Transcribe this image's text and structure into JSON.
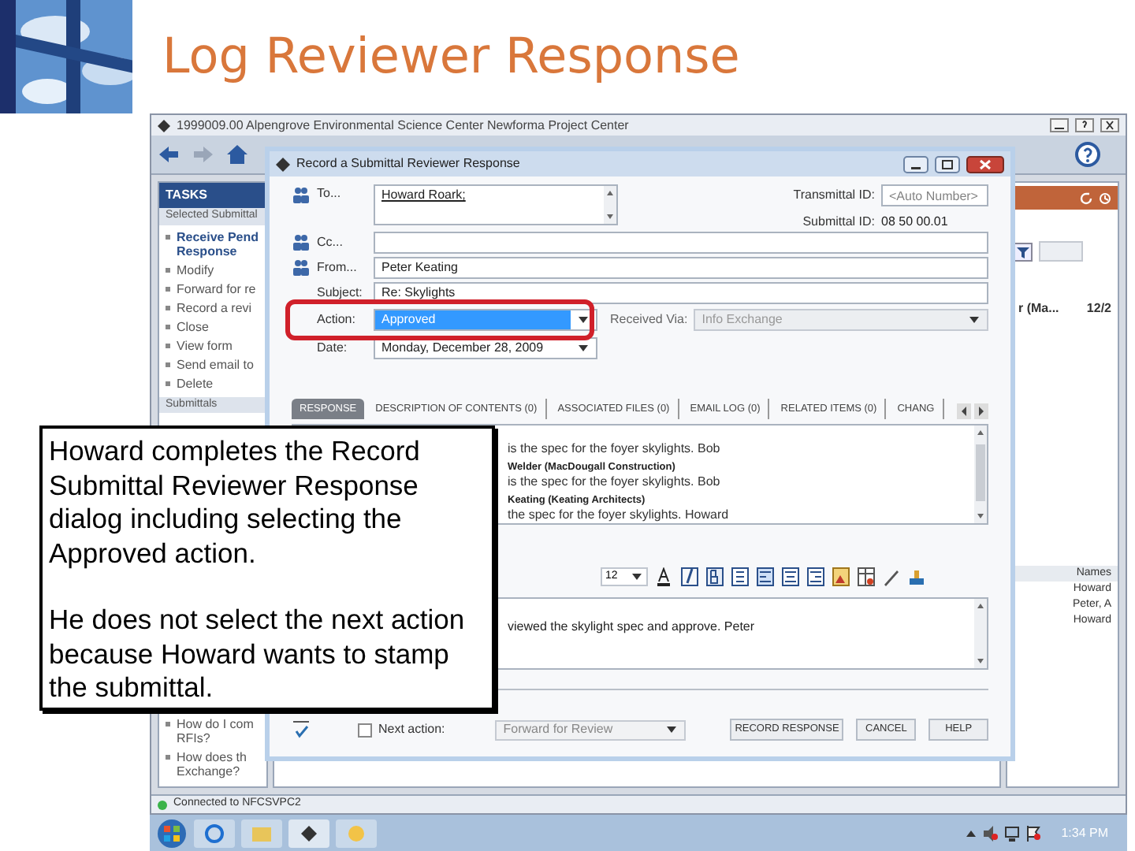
{
  "slide": {
    "title": "Log Reviewer Response"
  },
  "app": {
    "title": "1999009.00  Alpengrove Environmental Science Center  Newforma Project Center",
    "tasks": {
      "header": "TASKS",
      "section": "Selected Submittal",
      "items": [
        {
          "lines": [
            "Receive Pend",
            "Response"
          ],
          "bold": true
        },
        {
          "lines": [
            "Modify"
          ],
          "bold": false
        },
        {
          "lines": [
            "Forward for re"
          ],
          "bold": false
        },
        {
          "lines": [
            "Record a revi"
          ],
          "bold": false
        },
        {
          "lines": [
            "Close"
          ],
          "bold": false
        },
        {
          "lines": [
            "View form"
          ],
          "bold": false
        },
        {
          "lines": [
            "Send email to"
          ],
          "bold": false
        },
        {
          "lines": [
            "Delete"
          ],
          "bold": false
        }
      ],
      "section_2": "Submittals",
      "help_items": [
        {
          "lines": [
            "How do I com",
            "RFIs?"
          ]
        },
        {
          "lines": [
            "How does th",
            "Exchange?"
          ]
        }
      ]
    },
    "right_panel": {
      "cells": [
        "r (Ma...",
        "12/2"
      ],
      "names_header": "Names",
      "names": [
        "Howard",
        "Peter, A",
        "Howard"
      ]
    },
    "status": "Connected to NFCSVPC2",
    "clock": "1:34 PM"
  },
  "dialog": {
    "title": "Record a Submittal Reviewer Response",
    "to": {
      "label": "To...",
      "value": "Howard Roark;"
    },
    "transmittal_id": {
      "label": "Transmittal ID:",
      "placeholder": "<Auto Number>"
    },
    "submittal_id": {
      "label": "Submittal ID:",
      "value": "08 50 00.01"
    },
    "cc": {
      "label": "Cc..."
    },
    "from": {
      "label": "From...",
      "value": "Peter Keating"
    },
    "subject": {
      "label": "Subject:",
      "value": "Re: Skylights"
    },
    "action": {
      "label": "Action:",
      "value": "Approved",
      "highlighted": true
    },
    "received_via": {
      "label": "Received Via:",
      "value": "Info Exchange",
      "disabled": true
    },
    "date": {
      "label": "Date:",
      "value": "Monday, December 28, 2009"
    },
    "tabs": [
      {
        "label": "RESPONSE",
        "selected": true
      },
      {
        "label": "DESCRIPTION OF CONTENTS (0)",
        "selected": false
      },
      {
        "label": "ASSOCIATED FILES (0)",
        "selected": false
      },
      {
        "label": "EMAIL LOG (0)",
        "selected": false
      },
      {
        "label": "RELATED ITEMS (0)",
        "selected": false
      },
      {
        "label": "CHANG",
        "selected": false
      }
    ],
    "log": [
      {
        "kind": "text",
        "text": "is the spec for the foyer skylights.  Bob"
      },
      {
        "kind": "author",
        "text": "Welder (MacDougall Construction)"
      },
      {
        "kind": "text",
        "text": "is the spec for the foyer skylights.  Bob"
      },
      {
        "kind": "author",
        "text": "Keating (Keating Architects)"
      },
      {
        "kind": "text",
        "text": "the spec for the foyer skylights.  Howard"
      }
    ],
    "font_size": "12",
    "reply": "viewed the skylight spec and approve.  Peter",
    "next_action": {
      "label": "Next action:",
      "checked": false,
      "value": "Forward for Review"
    },
    "buttons": [
      "RECORD RESPONSE",
      "CANCEL",
      "HELP"
    ]
  },
  "callout": [
    "Howard completes the Record Submittal Reviewer Response dialog including selecting the Approved action.",
    "He does not select the next action because Howard wants to stamp the submittal."
  ]
}
